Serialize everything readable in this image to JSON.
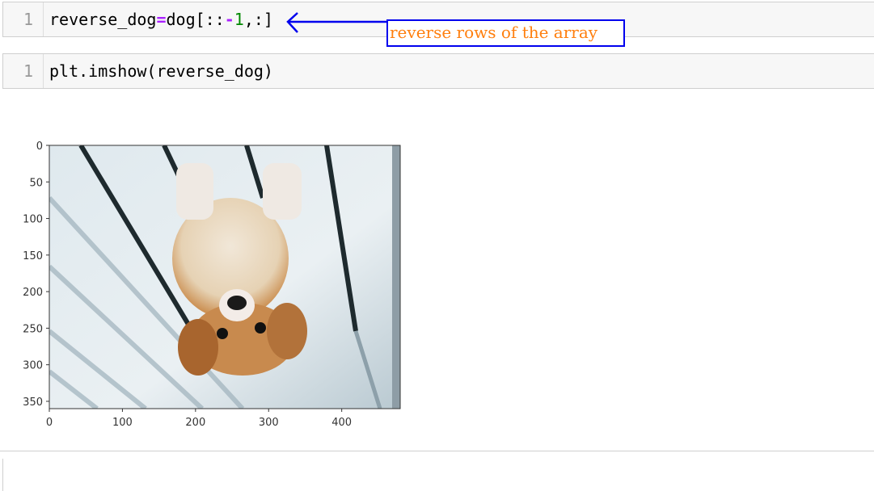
{
  "cells": [
    {
      "line_number": "1",
      "code_parts": [
        "reverse_dog",
        "=",
        "dog[::",
        "-",
        "1",
        ",:]"
      ]
    },
    {
      "line_number": "1",
      "code": "plt.imshow(reverse_dog)"
    }
  ],
  "annotation": {
    "text": "reverse rows of the array",
    "box_color": "#0000ee",
    "text_color": "#ff7f0e"
  },
  "plot": {
    "x_ticks": [
      "0",
      "100",
      "200",
      "300",
      "400"
    ],
    "y_ticks": [
      "0",
      "50",
      "100",
      "150",
      "200",
      "250",
      "300",
      "350"
    ],
    "image_description_icon": "upside-down-puppy-image"
  }
}
